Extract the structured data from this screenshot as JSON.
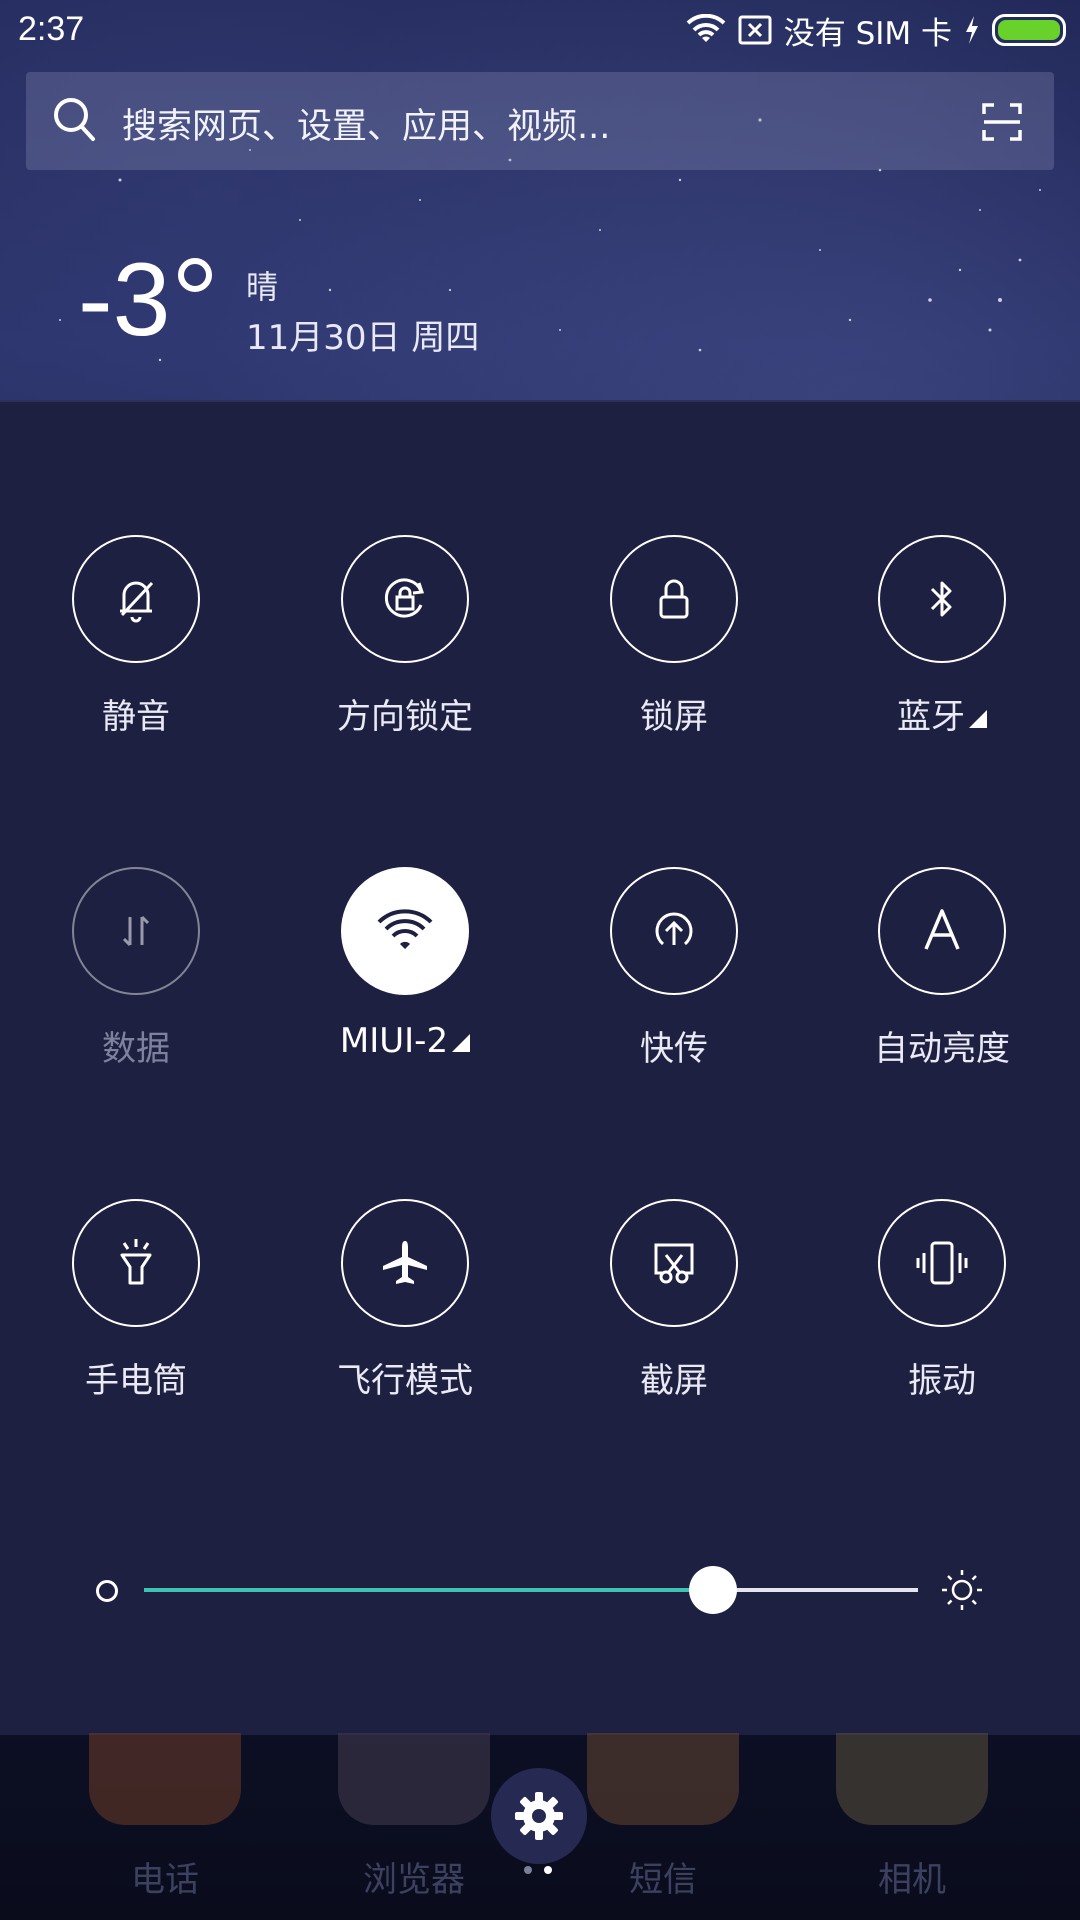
{
  "status": {
    "time": "2:37",
    "sim_text": "没有 SIM 卡",
    "battery_color": "#68d12a"
  },
  "search": {
    "placeholder": "搜索网页、设置、应用、视频..."
  },
  "weather": {
    "temperature": "-3",
    "condition": "晴",
    "date": "11月30日 周四"
  },
  "toggles": [
    {
      "label": "静音",
      "icon": "bell-off-icon",
      "state": "off"
    },
    {
      "label": "方向锁定",
      "icon": "rotation-lock-icon",
      "state": "off"
    },
    {
      "label": "锁屏",
      "icon": "lock-icon",
      "state": "off"
    },
    {
      "label": "蓝牙",
      "icon": "bluetooth-icon",
      "state": "off",
      "has_more": true
    },
    {
      "label": "数据",
      "icon": "mobile-data-icon",
      "state": "disabled"
    },
    {
      "label": "MIUI-2",
      "icon": "wifi-icon",
      "state": "on",
      "has_more": true
    },
    {
      "label": "快传",
      "icon": "quick-share-icon",
      "state": "off"
    },
    {
      "label": "自动亮度",
      "icon": "auto-brightness-icon",
      "state": "off"
    },
    {
      "label": "手电筒",
      "icon": "flashlight-icon",
      "state": "off"
    },
    {
      "label": "飞行模式",
      "icon": "airplane-icon",
      "state": "off"
    },
    {
      "label": "截屏",
      "icon": "screenshot-icon",
      "state": "off"
    },
    {
      "label": "振动",
      "icon": "vibrate-icon",
      "state": "off"
    }
  ],
  "brightness": {
    "level": 0.735,
    "fill_color": "#3ec2b4"
  },
  "dock": [
    {
      "label": "电话",
      "icon": "phone-icon"
    },
    {
      "label": "浏览器",
      "icon": "compass-icon"
    },
    {
      "label": "短信",
      "icon": "message-icon"
    },
    {
      "label": "相机",
      "icon": "camera-icon"
    }
  ],
  "page_indicator": {
    "pages": 2,
    "current": 2
  }
}
